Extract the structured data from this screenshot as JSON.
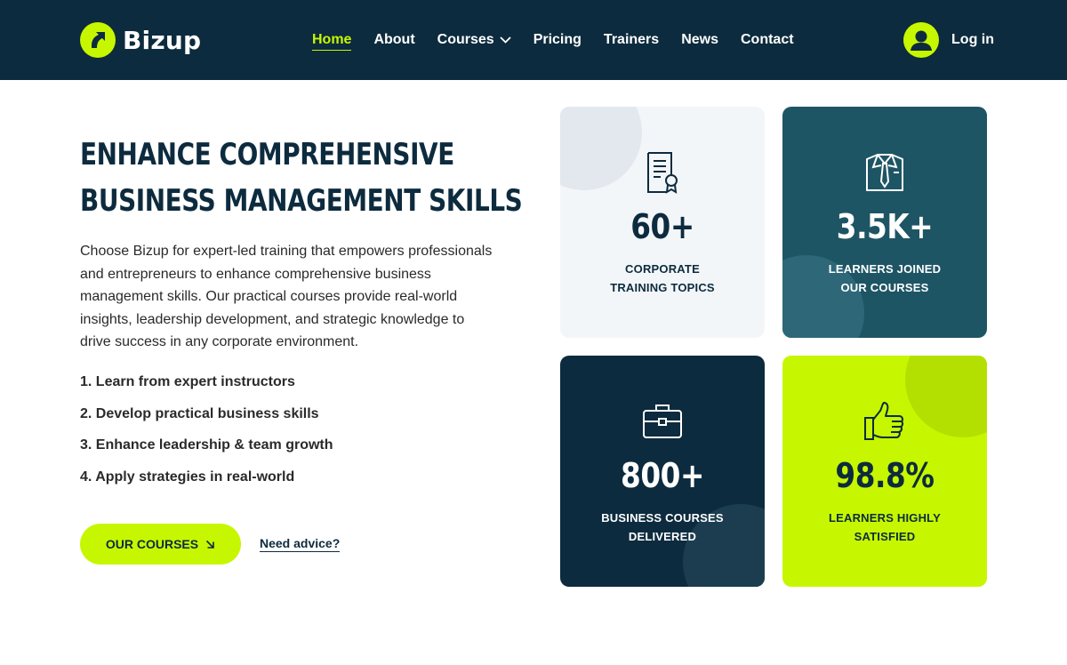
{
  "brand": {
    "name": "Bizup"
  },
  "nav": {
    "items": [
      {
        "label": "Home",
        "active": true
      },
      {
        "label": "About"
      },
      {
        "label": "Courses",
        "has_dropdown": true
      },
      {
        "label": "Pricing"
      },
      {
        "label": "Trainers"
      },
      {
        "label": "News"
      },
      {
        "label": "Contact"
      }
    ]
  },
  "account": {
    "login_label": "Log in"
  },
  "hero": {
    "title_line1": "ENHANCE COMPREHENSIVE",
    "title_line2": "BUSINESS MANAGEMENT SKILLS",
    "description": "Choose Bizup for expert-led training that empowers professionals and entrepreneurs to enhance comprehensive business management skills. Our practical courses provide real-world insights, leadership development, and strategic knowledge to drive success in any corporate environment.",
    "features": [
      "1. Learn from expert instructors",
      "2. Develop practical business skills",
      "3. Enhance leadership &  team growth",
      "4. Apply strategies in real-world"
    ],
    "cta_label": "OUR COURSES",
    "advice_label": "Need advice?"
  },
  "stats": [
    {
      "icon": "certificate-icon",
      "value": "60+",
      "label_line1": "CORPORATE",
      "label_line2": "TRAINING TOPICS"
    },
    {
      "icon": "shirt-tie-icon",
      "value": "3.5K+",
      "label_line1": "LEARNERS JOINED",
      "label_line2": "OUR COURSES"
    },
    {
      "icon": "briefcase-icon",
      "value": "800+",
      "label_line1": "BUSINESS COURSES",
      "label_line2": "DELIVERED"
    },
    {
      "icon": "thumbs-up-icon",
      "value": "98.8%",
      "label_line1": "LEARNERS HIGHLY",
      "label_line2": "SATISFIED"
    }
  ],
  "colors": {
    "navy": "#0d2b3e",
    "teal": "#1e5565",
    "lime": "#c6f700",
    "light": "#f3f6f9"
  }
}
